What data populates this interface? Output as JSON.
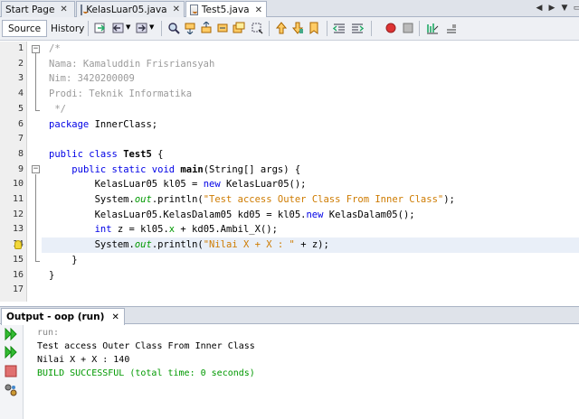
{
  "tabs": [
    {
      "label": "Start Page"
    },
    {
      "label": "KelasLuar05.java"
    },
    {
      "label": "Test5.java"
    }
  ],
  "toolbar": {
    "source_label": "Source",
    "history_label": "History"
  },
  "editor": {
    "file": "Test5.java",
    "line_numbers": [
      "1",
      "2",
      "3",
      "4",
      "5",
      "6",
      "7",
      "8",
      "9",
      "10",
      "11",
      "12",
      "13",
      "14",
      "15",
      "16",
      "17"
    ],
    "comment": {
      "open": "/*",
      "name": "Nama: Kamaluddin Frisriansyah",
      "nim": "Nim: 3420200009",
      "prodi": "Prodi: Teknik Informatika",
      "close": " */"
    },
    "package_kw": "package",
    "package_name": " InnerClass;",
    "class_kw": "public class",
    "class_name": "Test5",
    "class_open": " {",
    "main_kw": "public static void",
    "main_name": "main",
    "main_args": "(String[] args) {",
    "l10_a": "KelasLuar05 kl05 = ",
    "l10_new": "new",
    "l10_b": " KelasLuar05();",
    "l11_a": "System.",
    "l11_out": "out",
    "l11_b": ".println(",
    "l11_str": "\"Test access Outer Class From Inner Class\"",
    "l11_c": ");",
    "l12_a": "KelasLuar05.KelasDalam05 kd05 = kl05.",
    "l12_new": "new",
    "l12_b": " KelasDalam05();",
    "l13_int": "int",
    "l13_a": " z = kl05.",
    "l13_x": "x",
    "l13_b": " + kd05.",
    "l13_m": "Ambil_X",
    "l13_c": "();",
    "l14_a": "System.",
    "l14_out": "out",
    "l14_b": ".println(",
    "l14_str": "\"Nilai X + X : \"",
    "l14_c": " + z);",
    "l15": "}",
    "l16": "}",
    "highlight_line": 14
  },
  "output": {
    "tab_label": "Output - oop (run)",
    "lines": [
      "run:",
      "Test access Outer Class From Inner Class",
      "Nilai X + X : 140",
      "BUILD SUCCESSFUL (total time: 0 seconds)"
    ]
  },
  "colors": {
    "keyword": "#0000e6",
    "string": "#ce7b00",
    "field": "#009900",
    "comment": "#9a9a9a",
    "success": "#009900"
  },
  "icons": [
    "java-file-icon",
    "back-icon",
    "forward-icon",
    "find-icon",
    "toggle-bookmark-icon",
    "shift-left-icon",
    "shift-right-icon",
    "record-macro-icon",
    "stop-macro-icon",
    "breakpoint-icon",
    "run-icon",
    "rerun-icon",
    "stop-icon",
    "settings-icon",
    "lightbulb-icon"
  ]
}
